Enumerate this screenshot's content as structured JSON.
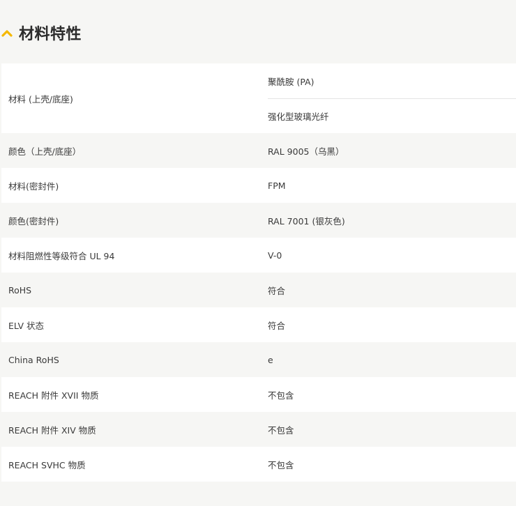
{
  "section": {
    "title": "材料特性",
    "accent_color": "#f5b800",
    "icon": "chevron-up-icon"
  },
  "rows": [
    {
      "label": "材料 (上壳/底座)",
      "values": [
        "聚酰胺 (PA)",
        "强化型玻璃光纤"
      ]
    },
    {
      "label": "颜色（上壳/底座）",
      "values": [
        "RAL 9005（乌黑）"
      ]
    },
    {
      "label": "材料(密封件)",
      "values": [
        "FPM"
      ]
    },
    {
      "label": "颜色(密封件)",
      "values": [
        "RAL 7001 (银灰色)"
      ]
    },
    {
      "label": "材料阻燃性等级符合 UL 94",
      "values": [
        "V-0"
      ]
    },
    {
      "label": "RoHS",
      "values": [
        "符合"
      ]
    },
    {
      "label": "ELV 状态",
      "values": [
        "符合"
      ]
    },
    {
      "label": "China RoHS",
      "values": [
        "e"
      ]
    },
    {
      "label": "REACH 附件 XVII 物质",
      "values": [
        "不包含"
      ]
    },
    {
      "label": "REACH 附件 XIV 物质",
      "values": [
        "不包含"
      ]
    },
    {
      "label": "REACH SVHC 物质",
      "values": [
        "不包含"
      ]
    }
  ]
}
